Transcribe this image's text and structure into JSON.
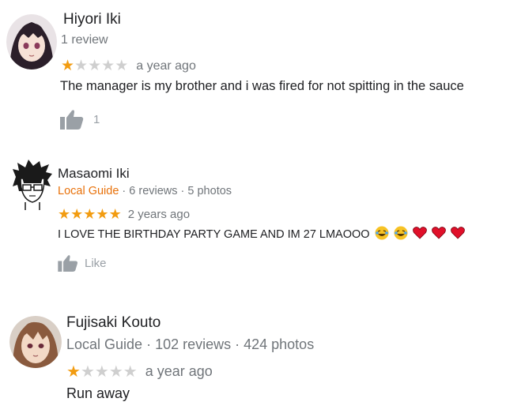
{
  "colors": {
    "star_on": "#f29c11",
    "star_off": "#cfcfcf",
    "local_guide": "#e8710a",
    "meta": "#70757a"
  },
  "reviews": [
    {
      "name": "Hiyori Iki",
      "meta": "1 review",
      "rating": 1,
      "date": "a year ago",
      "text": "The manager is my brother and i was fired for not spitting in the sauce",
      "like_icon": "thumbs-up-icon",
      "like_label": "1"
    },
    {
      "name": "Masaomi Iki",
      "local_guide": "Local Guide",
      "meta": " · 6 reviews · 5 photos",
      "rating": 5,
      "date": "2 years ago",
      "text": "I LOVE THE BIRTHDAY PARTY GAME AND IM 27 LMAOOO",
      "emojis": [
        "laughing-emoji",
        "laughing-emoji",
        "heart-emoji",
        "heart-emoji",
        "heart-emoji"
      ],
      "like_icon": "thumbs-up-icon",
      "like_label": "Like"
    },
    {
      "name": "Fujisaki Kouto",
      "local_guide": "Local Guide",
      "meta": " · 102 reviews · 424 photos",
      "rating": 1,
      "date": "a year ago",
      "text": "Run away"
    }
  ]
}
